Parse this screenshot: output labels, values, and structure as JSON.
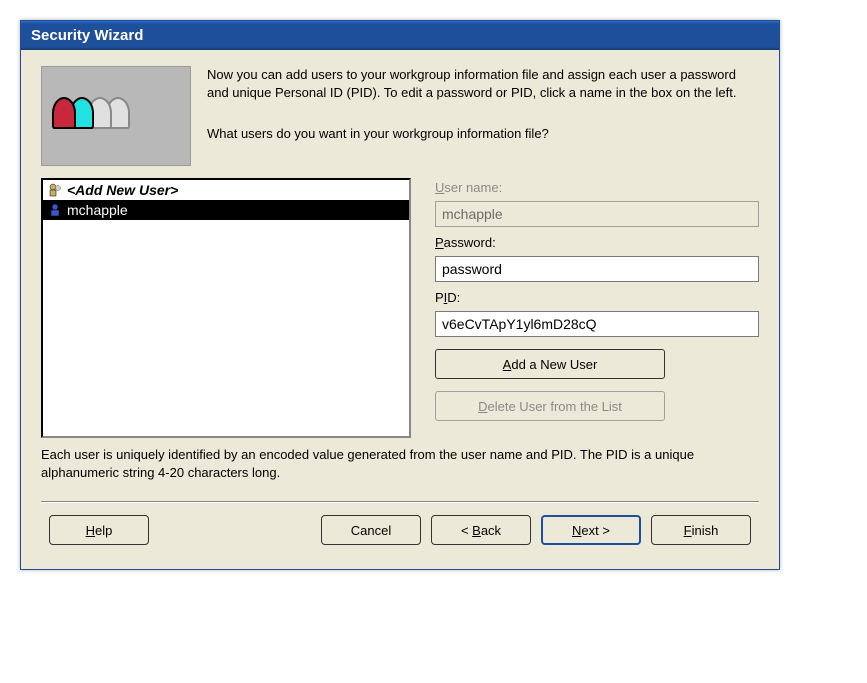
{
  "window": {
    "title": "Security Wizard"
  },
  "intro": {
    "instruction": "Now you can add users to your workgroup information file and assign each user a password and unique Personal ID (PID). To edit a password or PID, click a name in the box on the left.",
    "question": "What users do you want in your workgroup information file?"
  },
  "userlist": {
    "items": [
      {
        "label": "<Add New User>",
        "selected": false,
        "special": true
      },
      {
        "label": "mchapple",
        "selected": true,
        "special": false
      }
    ]
  },
  "form": {
    "username_label": "User name:",
    "username_value": "mchapple",
    "password_label": "Password:",
    "password_value": "password",
    "pid_label": "PID:",
    "pid_value": "v6eCvTApY1yl6mD28cQ",
    "add_button": "Add a New User",
    "delete_button": "Delete User from the List"
  },
  "footnote": "Each user is uniquely identified by an encoded value generated from the user name and PID. The PID is a unique alphanumeric string 4-20 characters long.",
  "buttons": {
    "help": "Help",
    "cancel": "Cancel",
    "back": "< Back",
    "next": "Next >",
    "finish": "Finish"
  }
}
